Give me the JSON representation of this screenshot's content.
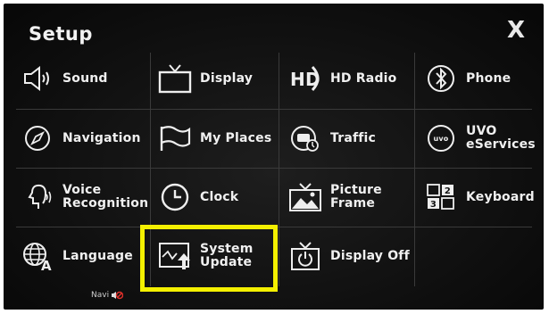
{
  "header": {
    "title": "Setup",
    "close_label": "X"
  },
  "menu": {
    "sound": "Sound",
    "display": "Display",
    "hd_radio": "HD Radio",
    "phone": "Phone",
    "navigation": "Navigation",
    "my_places": "My Places",
    "traffic": "Traffic",
    "uvo": "UVO\neServices",
    "voice": "Voice\nRecognition",
    "clock": "Clock",
    "picture_frame": "Picture\nFrame",
    "keyboard": "Keyboard",
    "language": "Language",
    "system_update": "System\nUpdate",
    "display_off": "Display Off"
  },
  "icons": {
    "hd_badge": "HD",
    "uvo_badge": "uvo",
    "keyboard_keys": [
      "",
      "2",
      "3",
      ""
    ]
  },
  "status": {
    "navi_label": "Navi"
  },
  "colors": {
    "highlight": "#f4f000",
    "mute": "#e0302a"
  }
}
